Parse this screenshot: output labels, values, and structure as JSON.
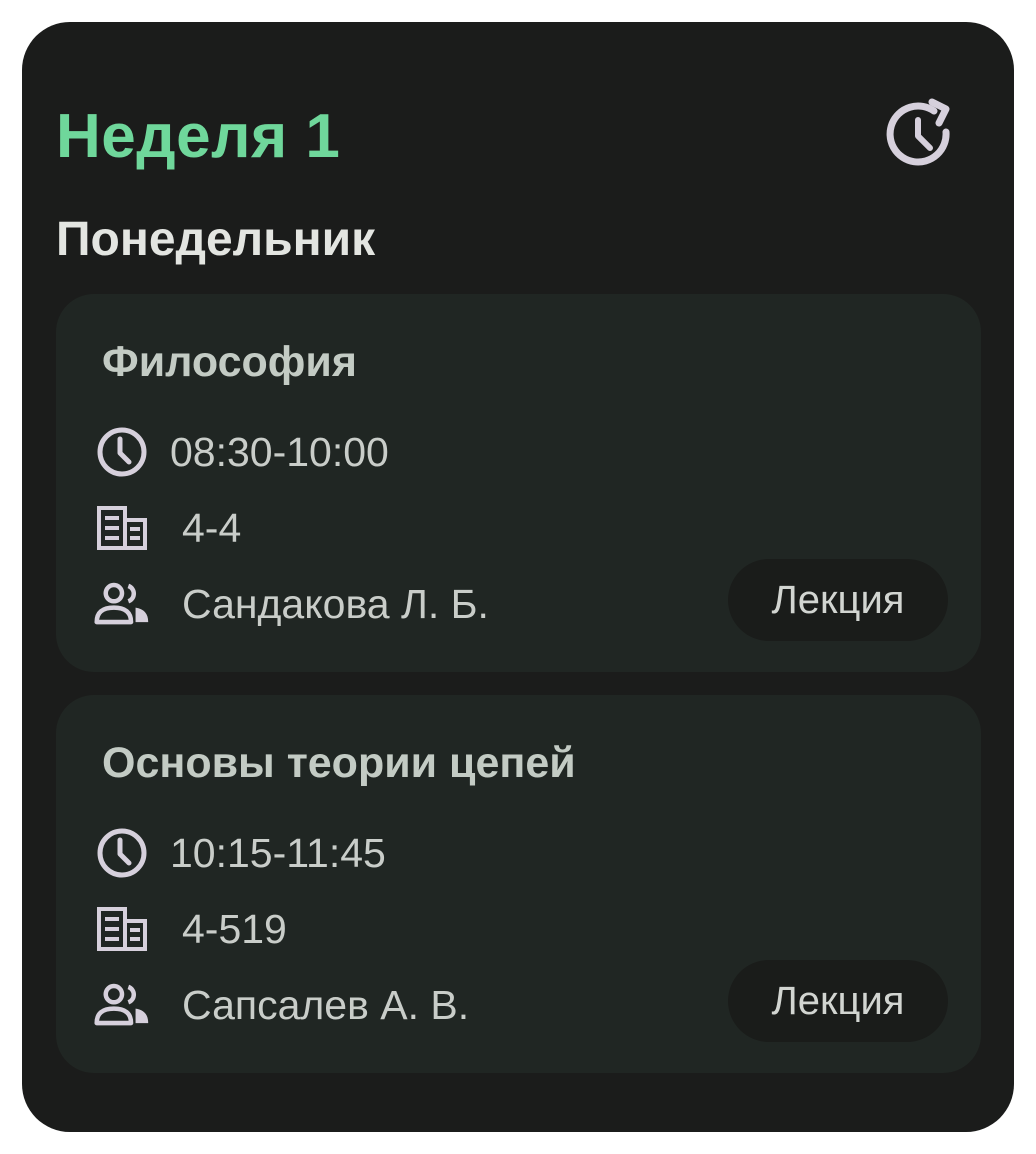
{
  "header": {
    "week_title": "Неделя 1",
    "history_icon": "history-icon"
  },
  "day": {
    "title": "Понедельник"
  },
  "lessons": [
    {
      "subject": "Философия",
      "time": "08:30-10:00",
      "room": "4-4",
      "teacher": "Сандакова Л. Б.",
      "type": "Лекция"
    },
    {
      "subject": "Основы теории цепей",
      "time": "10:15-11:45",
      "room": "4-519",
      "teacher": "Сапсалев А. В.",
      "type": "Лекция"
    }
  ],
  "icons": {
    "time": "clock-icon",
    "room": "building-icon",
    "teacher": "people-icon"
  },
  "colors": {
    "accent": "#6fd79b",
    "background": "#1b1c1b",
    "card": "#202623",
    "icon": "#d6d0dc"
  }
}
